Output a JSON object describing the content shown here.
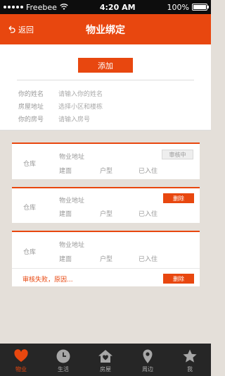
{
  "status_bar": {
    "carrier": "Freebee",
    "time": "4:20 AM",
    "battery": "100%"
  },
  "nav": {
    "back_label": "返回",
    "title": "物业绑定"
  },
  "form": {
    "add_label": "添加",
    "fields": [
      {
        "label": "你的姓名",
        "placeholder": "请输入你的姓名"
      },
      {
        "label": "房屋地址",
        "placeholder": "选择小区和楼栋"
      },
      {
        "label": "你的房号",
        "placeholder": "请输入房号"
      }
    ]
  },
  "cards": [
    {
      "warehouse": "仓库",
      "address": "物业地址",
      "building": "建面",
      "unit_type": "户型",
      "occupied": "已入住",
      "status_label": "审核中"
    },
    {
      "warehouse": "仓库",
      "address": "物业地址",
      "building": "建面",
      "unit_type": "户型",
      "occupied": "已入住",
      "action_label": "删除"
    },
    {
      "warehouse": "仓库",
      "address": "物业地址",
      "building": "建面",
      "unit_type": "户型",
      "occupied": "已入住",
      "fail_text": "审核失败，原因...",
      "action_label": "删除"
    }
  ],
  "tabs": [
    {
      "label": "物业",
      "icon": "heart-icon",
      "active": true
    },
    {
      "label": "生活",
      "icon": "clock-icon",
      "active": false
    },
    {
      "label": "房屋",
      "icon": "house-icon",
      "active": false
    },
    {
      "label": "周边",
      "icon": "location-pin-icon",
      "active": false
    },
    {
      "label": "我",
      "icon": "star-icon",
      "active": false
    }
  ],
  "colors": {
    "accent": "#e8470f",
    "tab_bar": "#262626",
    "background": "#e4dfd9"
  }
}
